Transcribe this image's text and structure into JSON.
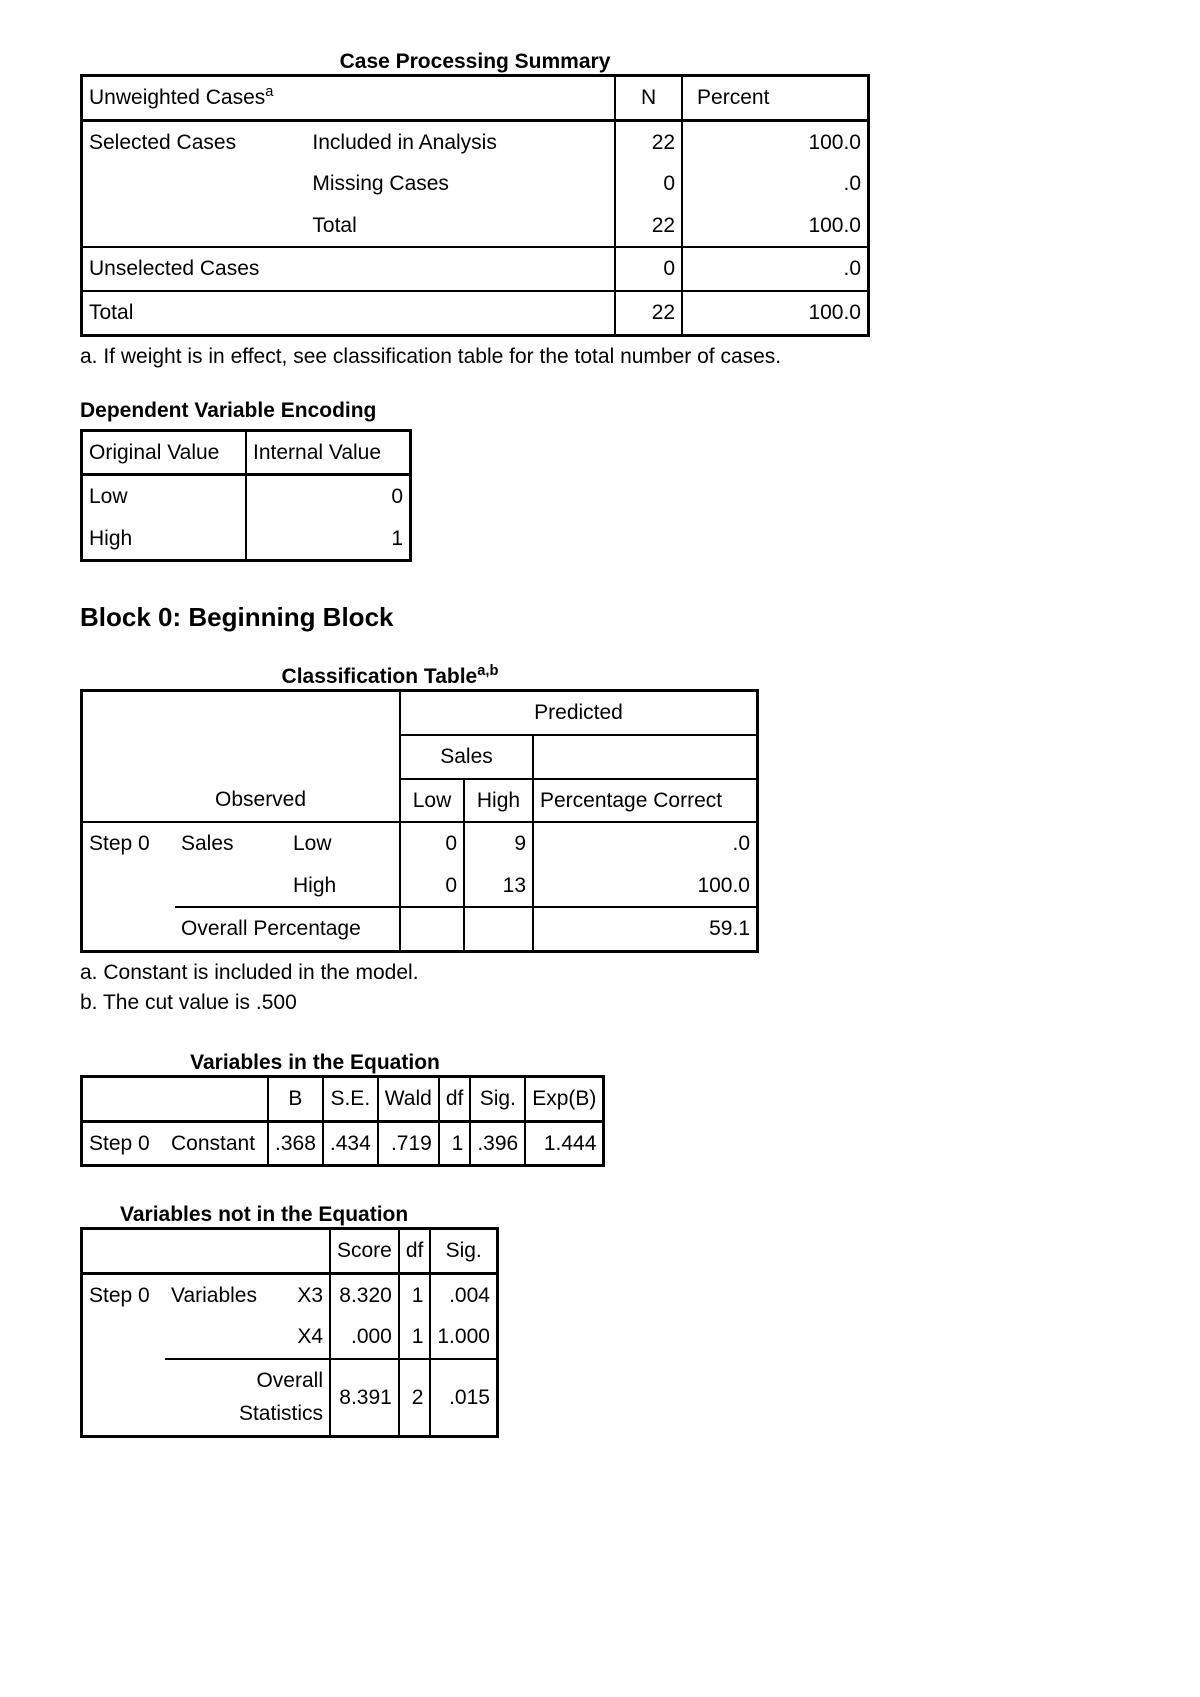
{
  "cps": {
    "title": "Case Processing Summary",
    "header": {
      "label": "Unweighted Cases",
      "sup": "a",
      "n": "N",
      "percent": "Percent"
    },
    "rows": [
      {
        "a": "Selected Cases",
        "b": "Included in Analysis",
        "n": "22",
        "p": "100.0"
      },
      {
        "a": "",
        "b": "Missing Cases",
        "n": "0",
        "p": ".0"
      },
      {
        "a": "",
        "b": "Total",
        "n": "22",
        "p": "100.0"
      },
      {
        "a": "Unselected Cases",
        "b": "",
        "n": "0",
        "p": ".0"
      },
      {
        "a": "Total",
        "b": "",
        "n": "22",
        "p": "100.0"
      }
    ],
    "footnote": "a. If weight is in effect, see classification table for the total number of cases."
  },
  "dve": {
    "title": "Dependent Variable Encoding",
    "header": {
      "orig": "Original Value",
      "internal": "Internal Value"
    },
    "rows": [
      {
        "orig": "Low",
        "internal": "0"
      },
      {
        "orig": "High",
        "internal": "1"
      }
    ]
  },
  "block0": {
    "title": "Block 0: Beginning Block"
  },
  "ct": {
    "title": "Classification Table",
    "sup": "a,b",
    "predicted": "Predicted",
    "sales": "Sales",
    "observed": "Observed",
    "low": "Low",
    "high": "High",
    "pc": "Percentage Correct",
    "step0": "Step 0",
    "sales_lbl": "Sales",
    "rows": [
      {
        "cat": "Low",
        "low": "0",
        "high": "9",
        "pc": ".0"
      },
      {
        "cat": "High",
        "low": "0",
        "high": "13",
        "pc": "100.0"
      }
    ],
    "overall_label": "Overall Percentage",
    "overall_pc": "59.1",
    "foot_a": "a. Constant is included in the model.",
    "foot_b": "b. The cut value is .500"
  },
  "vie": {
    "title": "Variables in the Equation",
    "hdr": {
      "b": "B",
      "se": "S.E.",
      "wald": "Wald",
      "df": "df",
      "sig": "Sig.",
      "expb": "Exp(B)"
    },
    "row": {
      "step": "Step 0",
      "var": "Constant",
      "b": ".368",
      "se": ".434",
      "wald": ".719",
      "df": "1",
      "sig": ".396",
      "expb": "1.444"
    }
  },
  "vne": {
    "title": "Variables not in the Equation",
    "hdr": {
      "score": "Score",
      "df": "df",
      "sig": "Sig."
    },
    "rows": [
      {
        "a": "Step 0",
        "b": "Variables",
        "c": "X3",
        "score": "8.320",
        "df": "1",
        "sig": ".004"
      },
      {
        "a": "",
        "b": "",
        "c": "X4",
        "score": ".000",
        "df": "1",
        "sig": "1.000"
      },
      {
        "a": "",
        "b": "Overall Statistics",
        "c": "",
        "score": "8.391",
        "df": "2",
        "sig": ".015"
      }
    ]
  }
}
